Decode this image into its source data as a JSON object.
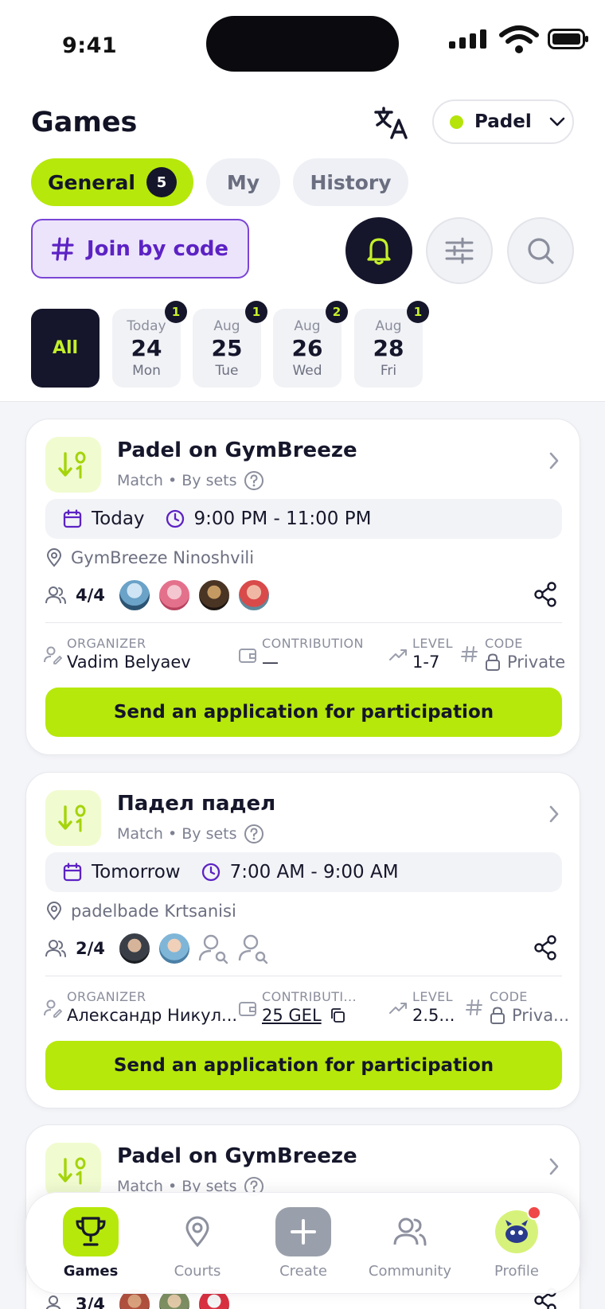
{
  "status_bar": {
    "time": "9:41"
  },
  "header": {
    "title": "Games",
    "sport": "Padel"
  },
  "tabs": [
    {
      "label": "General",
      "count": "5"
    },
    {
      "label": "My"
    },
    {
      "label": "History"
    }
  ],
  "join_label": "Join by code",
  "dates": {
    "all_label": "All",
    "items": [
      {
        "month": "Today",
        "day": "24",
        "weekday": "Mon",
        "count": "1"
      },
      {
        "month": "Aug",
        "day": "25",
        "weekday": "Tue",
        "count": "1"
      },
      {
        "month": "Aug",
        "day": "26",
        "weekday": "Wed",
        "count": "2"
      },
      {
        "month": "Aug",
        "day": "28",
        "weekday": "Fri",
        "count": "1"
      }
    ]
  },
  "labels": {
    "organizer": "ORGANIZER",
    "contribution": "CONTRIBUTION",
    "contribution_short": "CONTRIBUTI...",
    "level": "LEVEL",
    "code": "CODE",
    "apply": "Send an application for participation"
  },
  "games": [
    {
      "title": "Padel on GymBreeze",
      "subtitle": "Match • By sets",
      "date": "Today",
      "time": "9:00 PM - 11:00 PM",
      "location": "GymBreeze Ninoshvili",
      "players": "4/4",
      "organizer": "Vadim Belyaev",
      "contribution": "—",
      "level": "1-7",
      "code": "Private"
    },
    {
      "title": "Падел падел",
      "subtitle": "Match • By sets",
      "date": "Tomorrow",
      "time": "7:00 AM - 9:00 AM",
      "location": "padelbade Krtsanisi",
      "players": "2/4",
      "organizer": "Александр Никул...",
      "contribution": "25 GEL",
      "level": "2.5...",
      "code": "Priva..."
    },
    {
      "title": "Padel on GymBreeze",
      "subtitle": "Match • By sets",
      "players": "3/4"
    }
  ],
  "nav": {
    "games": "Games",
    "courts": "Courts",
    "create": "Create",
    "community": "Community",
    "profile": "Profile"
  },
  "colors": {
    "accent": "#b6e80b",
    "dark": "#15162b",
    "purple": "#5c22c4",
    "badge_red": "#f04848"
  }
}
